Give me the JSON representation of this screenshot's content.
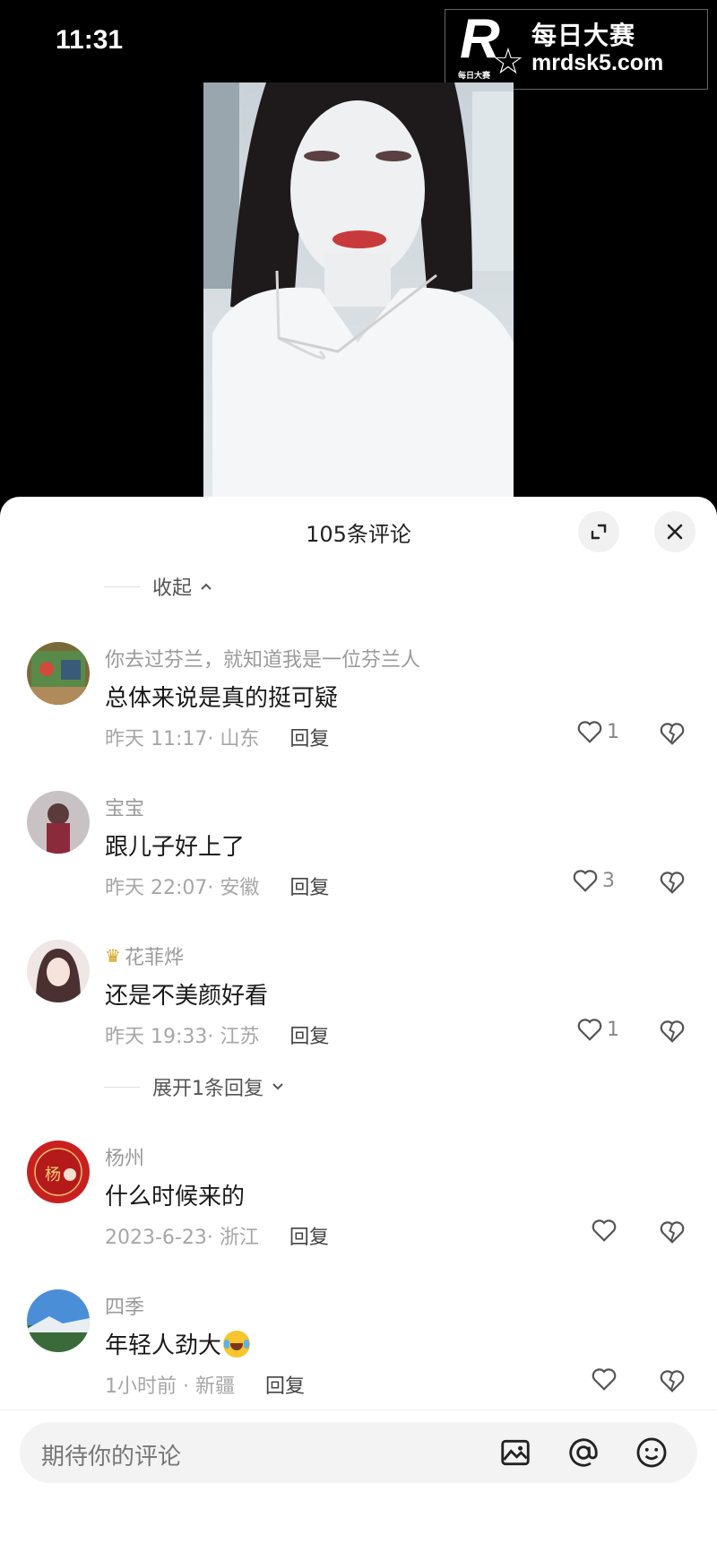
{
  "status": {
    "time": "11:31"
  },
  "watermark": {
    "brand_cn": "每日大赛",
    "url": "mrdsk5.com",
    "logo_letter": "R",
    "logo_small": "每日大赛"
  },
  "sheet": {
    "title": "105条评论",
    "collapse_label": "收起"
  },
  "comments": [
    {
      "user": "你去过芬兰，就知道我是一位芬兰人",
      "text": "总体来说是真的挺可疑",
      "time": "昨天 11:17· 山东",
      "reply": "回复",
      "likes": "1"
    },
    {
      "user": "宝宝",
      "text": "跟儿子好上了",
      "time": "昨天 22:07· 安徽",
      "reply": "回复",
      "likes": "3"
    },
    {
      "user": "花菲烨",
      "text": "还是不美颜好看",
      "time": "昨天 19:33· 江苏",
      "reply": "回复",
      "likes": "1"
    },
    {
      "user": "杨州",
      "text": "什么时候来的",
      "time": "2023-6-23· 浙江",
      "reply": "回复",
      "likes": ""
    },
    {
      "user": "四季",
      "text": "年轻人劲大",
      "time": "1小时前 · 新疆",
      "reply": "回复",
      "likes": ""
    }
  ],
  "expand_replies": "展开1条回复",
  "avatar4_text": "杨",
  "input": {
    "placeholder": "期待你的评论"
  }
}
